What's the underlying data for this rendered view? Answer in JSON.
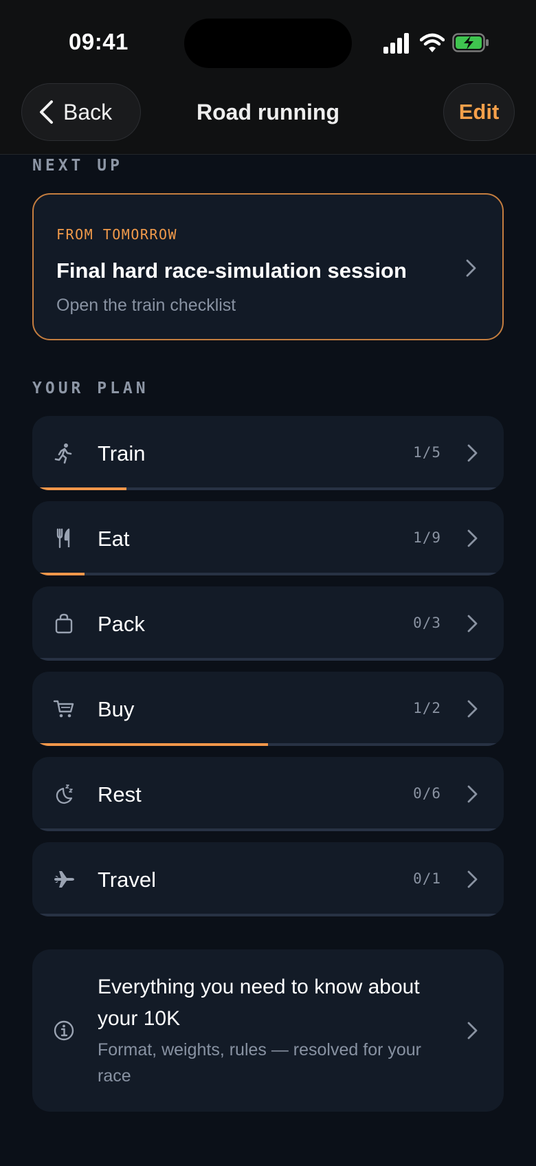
{
  "status_bar": {
    "time": "09:41"
  },
  "nav": {
    "back_label": "Back",
    "title": "Road running",
    "edit_label": "Edit"
  },
  "next_up": {
    "section_label": "NEXT UP",
    "eyebrow": "FROM TOMORROW",
    "title": "Final hard race-simulation session",
    "subtitle": "Open the train checklist"
  },
  "plan": {
    "section_label": "YOUR PLAN",
    "items": [
      {
        "label": "Train",
        "count": "1/5",
        "icon": "runner-icon",
        "progress": 0.2
      },
      {
        "label": "Eat",
        "count": "1/9",
        "icon": "fork-knife-icon",
        "progress": 0.111
      },
      {
        "label": "Pack",
        "count": "0/3",
        "icon": "bag-icon",
        "progress": 0
      },
      {
        "label": "Buy",
        "count": "1/2",
        "icon": "cart-icon",
        "progress": 0.5
      },
      {
        "label": "Rest",
        "count": "0/6",
        "icon": "moon-sleep-icon",
        "progress": 0
      },
      {
        "label": "Travel",
        "count": "0/1",
        "icon": "airplane-icon",
        "progress": 0
      }
    ]
  },
  "info": {
    "title": "Everything you need to know about your 10K",
    "subtitle": "Format, weights, rules — resolved for your race"
  },
  "colors": {
    "accent": "#f4974a",
    "background": "#0b1018",
    "card": "#131b27",
    "muted_text": "#8892a2"
  }
}
